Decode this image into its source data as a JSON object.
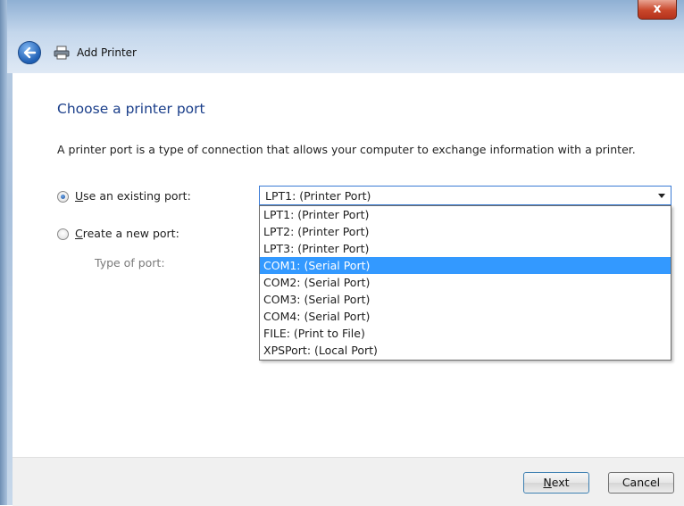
{
  "window": {
    "title": "Add Printer",
    "close_glyph": "x"
  },
  "page": {
    "title": "Choose a printer port",
    "description": "A printer port is a type of connection that allows your computer to exchange information with a printer."
  },
  "options": {
    "existing": {
      "prefix": "",
      "accel": "U",
      "rest": "se an existing port:",
      "checked": true
    },
    "new": {
      "prefix": "",
      "accel": "C",
      "rest": "reate a new port:",
      "checked": false
    },
    "type_label": "Type of port:"
  },
  "combo": {
    "value": "LPT1: (Printer Port)"
  },
  "dropdown": {
    "items": [
      "LPT1: (Printer Port)",
      "LPT2: (Printer Port)",
      "LPT3: (Printer Port)",
      "COM1: (Serial Port)",
      "COM2: (Serial Port)",
      "COM3: (Serial Port)",
      "COM4: (Serial Port)",
      "FILE: (Print to File)",
      "XPSPort: (Local Port)"
    ],
    "selected_index": 3
  },
  "buttons": {
    "next": {
      "accel": "N",
      "rest": "ext"
    },
    "cancel": "Cancel"
  },
  "icons": {
    "back": "back-arrow-icon",
    "printer": "printer-icon",
    "close": "close-icon"
  },
  "colors": {
    "title_blue": "#1a3e8a",
    "selection": "#3399ff",
    "close_red": "#c9472b"
  }
}
